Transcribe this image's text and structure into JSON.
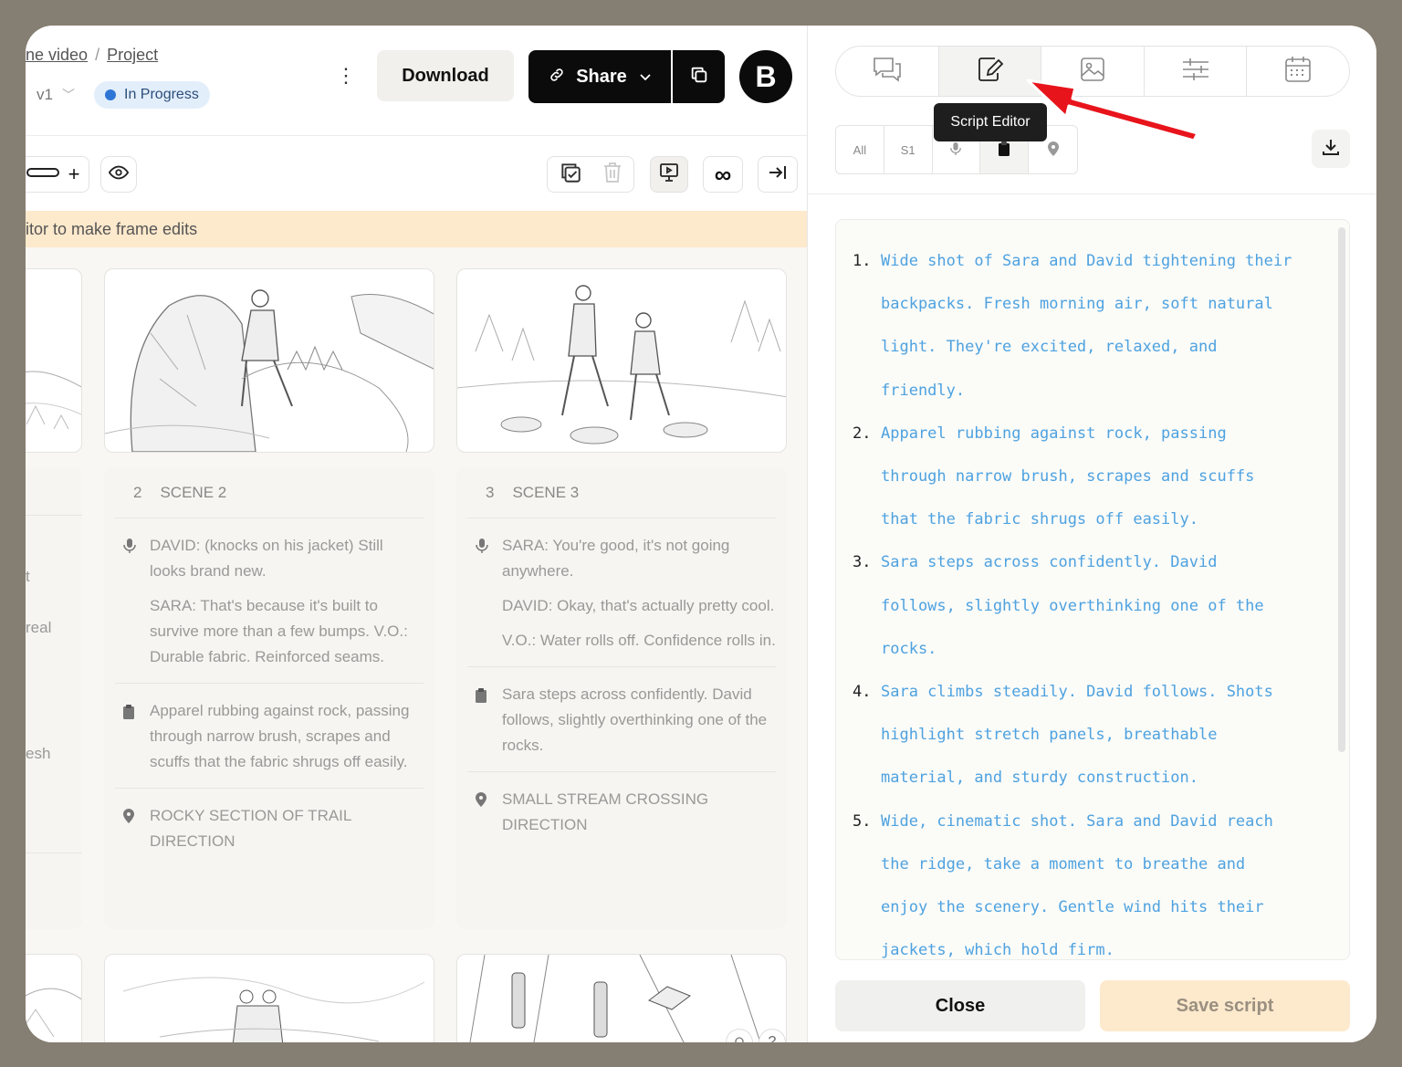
{
  "breadcrumb": {
    "parent": "ne video",
    "current": "Project"
  },
  "version": {
    "label": "v1"
  },
  "status": {
    "label": "In Progress",
    "color": "#2e76d6"
  },
  "toolbar": {
    "download_label": "Download",
    "share_label": "Share",
    "avatar_letter": "B"
  },
  "banner": {
    "text": "itor to make frame edits"
  },
  "left_edge": {
    "texts": [
      "t",
      "real",
      "esh"
    ]
  },
  "scenes": [
    {
      "number": "2",
      "title": "SCENE 2",
      "dialogue": [
        "DAVID: (knocks on his jacket) Still looks brand new.",
        "SARA: That's because it's built to survive more than a few bumps. V.O.: Durable fabric. Reinforced seams."
      ],
      "action": "Apparel rubbing against rock, passing through narrow brush, scrapes and scuffs that the fabric shrugs off easily.",
      "location": "ROCKY SECTION OF TRAIL DIRECTION"
    },
    {
      "number": "3",
      "title": "SCENE 3",
      "dialogue": [
        "SARA: You're good, it's not going anywhere.",
        "DAVID: Okay, that's actually pretty cool.",
        "V.O.: Water rolls off. Confidence rolls in."
      ],
      "action": "Sara steps across confidently. David follows, slightly overthinking one of the rocks.",
      "location": "SMALL STREAM CROSSING DIRECTION"
    }
  ],
  "right_panel": {
    "tabs": [
      {
        "icon": "comments-icon"
      },
      {
        "icon": "script-edit-icon",
        "active": true
      },
      {
        "icon": "image-icon"
      },
      {
        "icon": "sliders-icon"
      },
      {
        "icon": "calendar-icon"
      }
    ],
    "tooltip": "Script Editor",
    "filters": [
      {
        "label": "All"
      },
      {
        "label": "S1"
      },
      {
        "icon": "microphone-icon"
      },
      {
        "icon": "clipboard-icon"
      },
      {
        "icon": "location-pin-icon"
      }
    ],
    "script_lines": [
      {
        "num": "1.",
        "lines": [
          "Wide shot of Sara and David tightening their",
          "backpacks. Fresh morning air, soft natural",
          "light. They're excited, relaxed, and",
          "friendly."
        ]
      },
      {
        "num": "2.",
        "lines": [
          "Apparel rubbing against rock, passing",
          "through narrow brush, scrapes and scuffs",
          "that the fabric shrugs off easily."
        ]
      },
      {
        "num": "3.",
        "lines": [
          "Sara steps across confidently. David",
          "follows, slightly overthinking one of the",
          "rocks."
        ]
      },
      {
        "num": "4.",
        "lines": [
          "Sara climbs steadily. David follows. Shots",
          "highlight stretch panels, breathable",
          "material, and sturdy construction."
        ]
      },
      {
        "num": "5.",
        "lines": [
          "Wide, cinematic shot. Sara and David reach",
          "the ridge, take a moment to breathe and",
          "enjoy the scenery. Gentle wind hits their",
          "jackets, which hold firm."
        ]
      }
    ],
    "close_label": "Close",
    "save_label": "Save script"
  },
  "help": {
    "label": "?"
  },
  "colors": {
    "accent": "#4ea2e0",
    "banner": "#fde9cc",
    "arrow": "#e8141c"
  }
}
